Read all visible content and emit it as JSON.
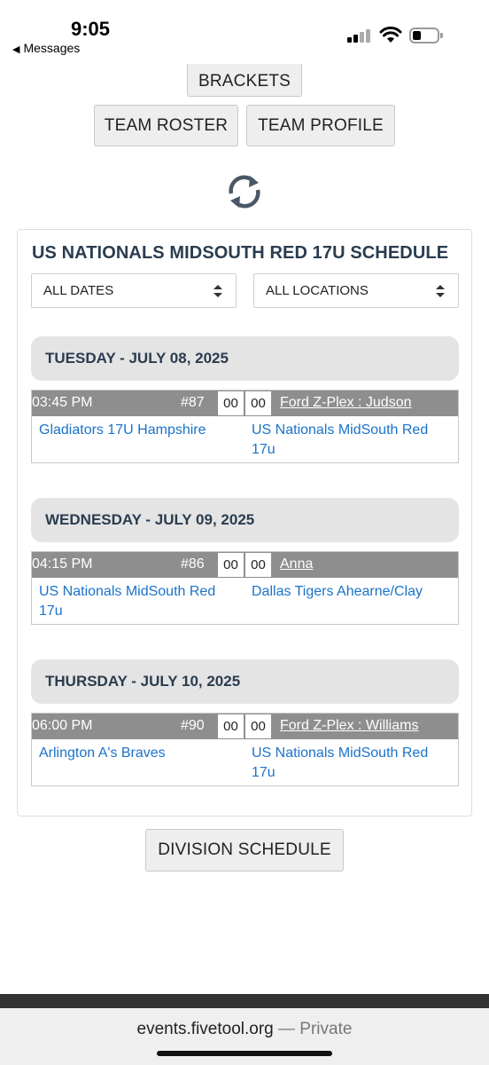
{
  "status_bar": {
    "time": "9:05",
    "back_label": "Messages",
    "back_icon": "back-triangle-icon"
  },
  "nav_buttons": {
    "brackets": "BRACKETS",
    "team_roster": "TEAM ROSTER",
    "team_profile": "TEAM PROFILE"
  },
  "schedule": {
    "title": "US NATIONALS MIDSOUTH RED 17U SCHEDULE",
    "filters": {
      "dates": "ALL DATES",
      "locations": "ALL LOCATIONS"
    },
    "days": [
      {
        "header": "TUESDAY - JULY 08, 2025",
        "game": {
          "time": "03:45 PM",
          "number": "#87",
          "score_home": "00",
          "score_away": "00",
          "location": "Ford Z-Plex : Judson",
          "team_left": "Gladiators 17U Hampshire",
          "team_right": "US Nationals MidSouth Red 17u"
        }
      },
      {
        "header": "WEDNESDAY - JULY 09, 2025",
        "game": {
          "time": "04:15 PM",
          "number": "#86",
          "score_home": "00",
          "score_away": "00",
          "location": "Anna",
          "team_left": "US Nationals MidSouth Red 17u",
          "team_right": "Dallas Tigers Ahearne/Clay"
        }
      },
      {
        "header": "THURSDAY - JULY 10, 2025",
        "game": {
          "time": "06:00 PM",
          "number": "#90",
          "score_home": "00",
          "score_away": "00",
          "location": "Ford Z-Plex : Williams",
          "team_left": "Arlington A's Braves",
          "team_right": "US Nationals MidSouth Red 17u"
        }
      }
    ]
  },
  "division_schedule_label": "DIVISION SCHEDULE",
  "browser": {
    "url": "events.fivetool.org",
    "privacy": "— Private"
  },
  "colors": {
    "heading": "#2a3c4f",
    "link": "#1a73c9",
    "game_bar": "#8e8e8e",
    "day_header_bg": "#e4e4e4"
  }
}
